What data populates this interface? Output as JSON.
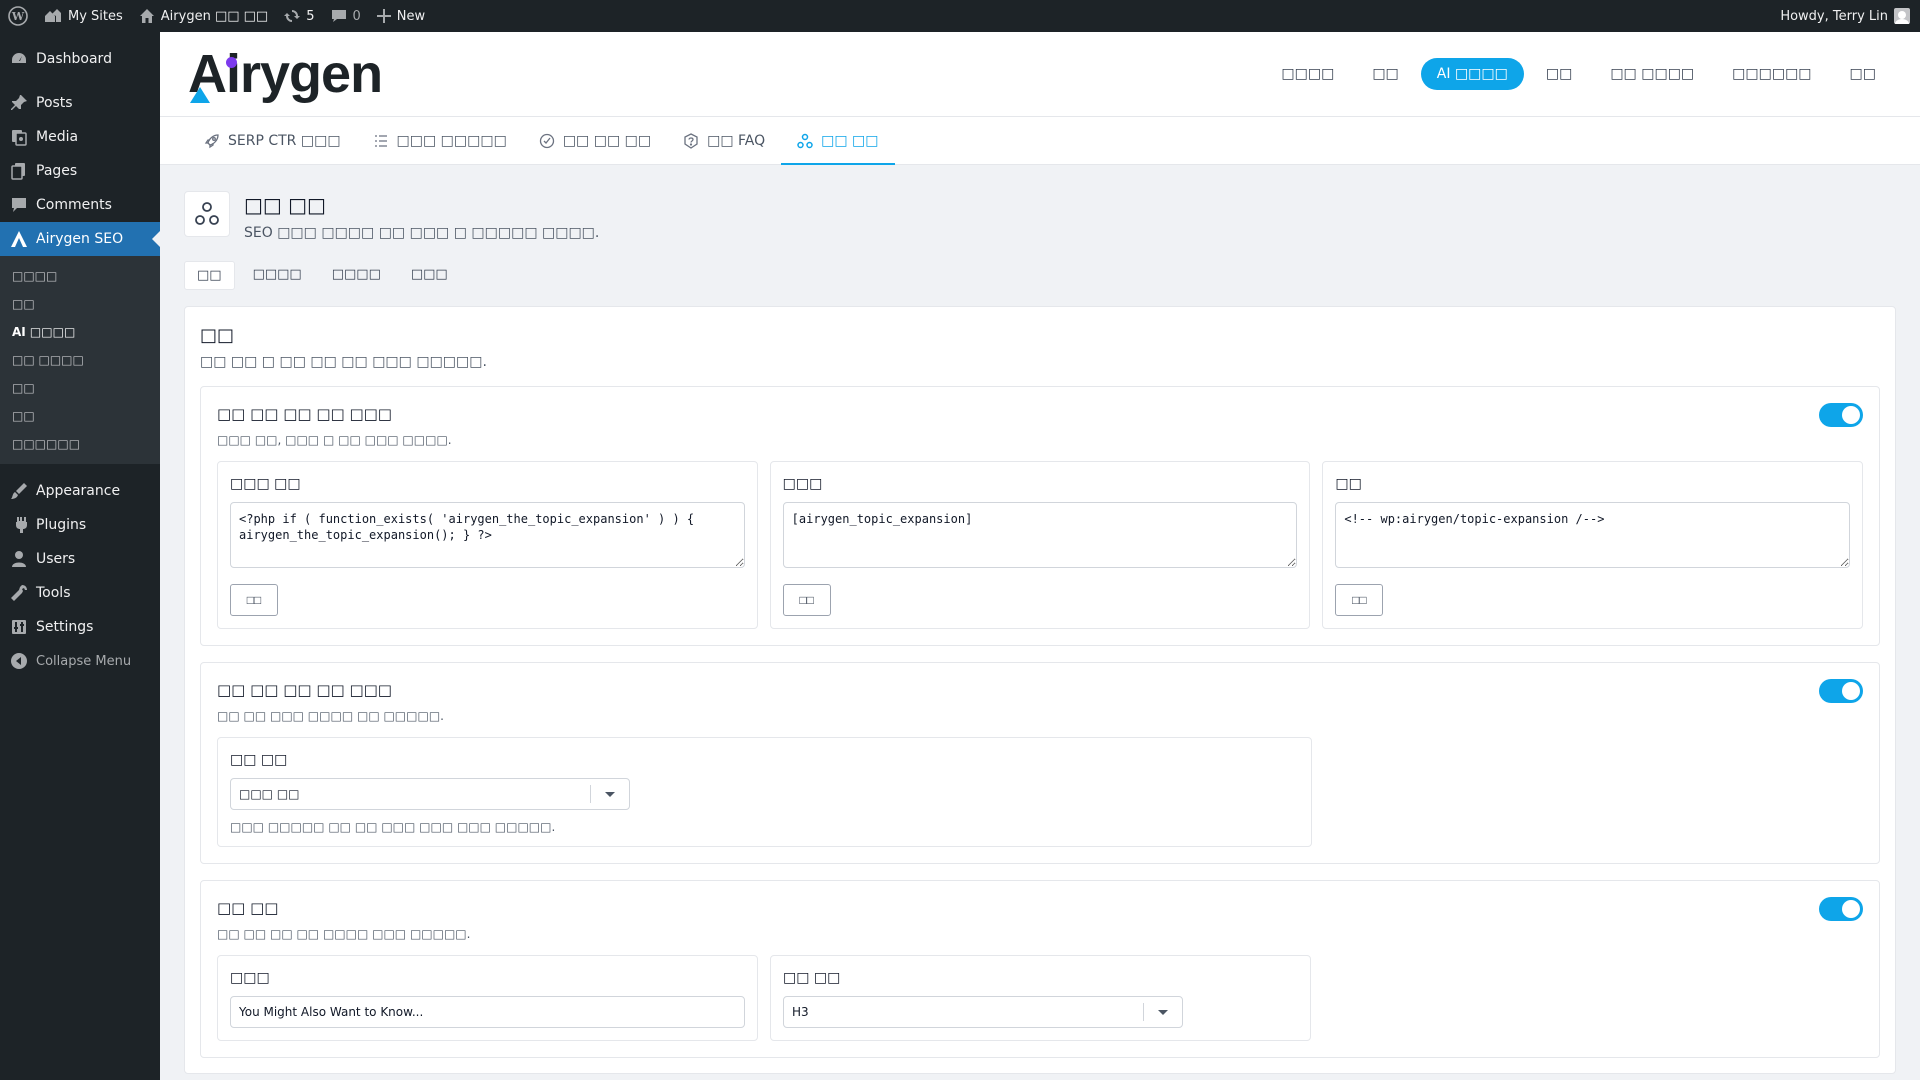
{
  "adminbar": {
    "my_sites": "My Sites",
    "site_name": "Airygen □□ □□",
    "updates": "5",
    "comments": "0",
    "new": "New",
    "howdy": "Howdy, Terry Lin"
  },
  "sidebar": {
    "items_top": [
      {
        "label": "Dashboard",
        "icon": "dashboard-icon"
      }
    ],
    "items": [
      {
        "label": "Posts",
        "icon": "pin-icon"
      },
      {
        "label": "Media",
        "icon": "media-icon"
      },
      {
        "label": "Pages",
        "icon": "pages-icon"
      },
      {
        "label": "Comments",
        "icon": "comment-icon"
      },
      {
        "label": "Airygen SEO",
        "icon": "airygen-icon"
      }
    ],
    "submenu": [
      "□□□□",
      "□□",
      "AI □□□□",
      "□□ □□□□",
      "□□",
      "□□",
      "□□□□□□"
    ],
    "items_bottom": [
      {
        "label": "Appearance",
        "icon": "appearance-icon"
      },
      {
        "label": "Plugins",
        "icon": "plugin-icon"
      },
      {
        "label": "Users",
        "icon": "user-icon"
      },
      {
        "label": "Tools",
        "icon": "tools-icon"
      },
      {
        "label": "Settings",
        "icon": "settings-icon"
      }
    ],
    "collapse": "Collapse Menu"
  },
  "header": {
    "brand_first": "A",
    "brand_rest": "irygen",
    "nav": [
      "□□□□",
      "□□",
      "AI □□□□",
      "□□",
      "□□ □□□□",
      "□□□□□□",
      "□□"
    ],
    "nav_active_index": 2
  },
  "subtabs": [
    "SERP CTR □□□",
    "□□□ □□□□□",
    "□□ □□ □□",
    "□□ FAQ",
    "□□ □□"
  ],
  "page": {
    "title": "□□ □□",
    "description": "SEO □□□ □□□□ □□ □□□ □ □□□□□ □□□□.",
    "inner_tabs": [
      "□□",
      "□□□□",
      "□□□□",
      "□□□"
    ]
  },
  "panel": {
    "title": "□□",
    "description": "□□ □□ □ □□ □□ □□ □□□ □□□□□."
  },
  "card1": {
    "title": "□□ □□ □□ □□ □□□",
    "description": "□□□ □□, □□□ □ □□ □□□ □□□□.",
    "boxes": [
      {
        "label": "□□□ □□",
        "code": "<?php if ( function_exists( 'airygen_the_topic_expansion' ) ) {\nairygen_the_topic_expansion(); } ?>",
        "button": "□□"
      },
      {
        "label": "□□□",
        "code": "[airygen_topic_expansion]",
        "button": "□□"
      },
      {
        "label": "□□",
        "code": "<!-- wp:airygen/topic-expansion /-->",
        "button": "□□"
      }
    ]
  },
  "card2": {
    "title": "□□ □□ □□ □□ □□□",
    "description": "□□ □□ □□□ □□□□ □□ □□□□□.",
    "field_label": "□□ □□",
    "select_value": "□□□ □□",
    "help": "□□□ □□□□□ □□ □□ □□□ □□□ □□□ □□□□□."
  },
  "card3": {
    "title": "□□ □□",
    "description": "□□ □□ □□ □□ □□□□ □□□ □□□□□.",
    "heading_label": "□□□",
    "heading_value": "You Might Also Want to Know...",
    "level_label": "□□ □□",
    "level_value": "H3"
  },
  "colors": {
    "accent": "#0ea5e9",
    "wp_blue": "#2271b1",
    "sidebar_bg": "#1d2327"
  }
}
